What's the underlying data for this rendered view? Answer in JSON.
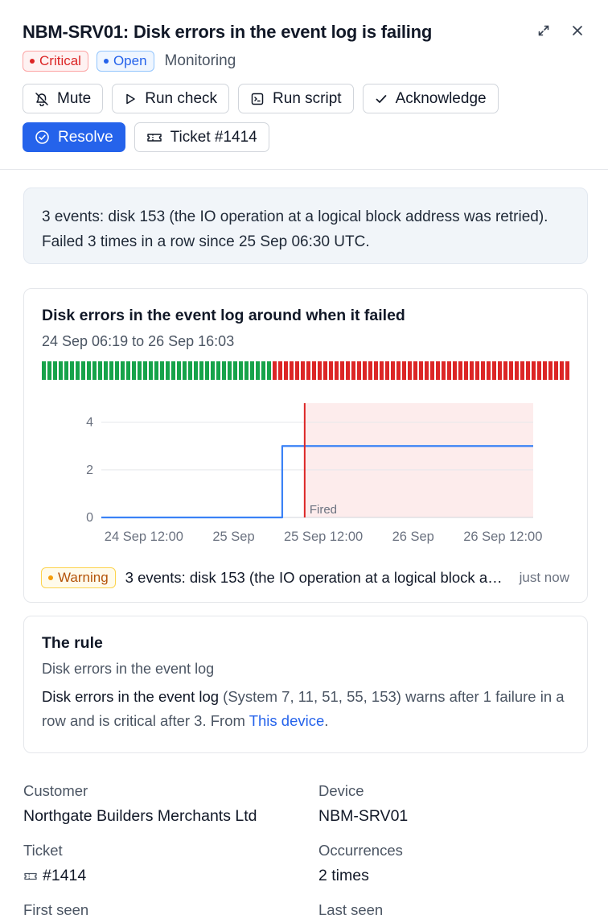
{
  "header": {
    "title": "NBM-SRV01: Disk errors in the event log is failing",
    "severity": "Critical",
    "status": "Open",
    "category": "Monitoring",
    "expand_icon": "expand-icon",
    "close_icon": "close-icon"
  },
  "actions": {
    "mute": "Mute",
    "run_check": "Run check",
    "run_script": "Run script",
    "acknowledge": "Acknowledge",
    "resolve": "Resolve",
    "ticket": "Ticket #1414"
  },
  "summary": "3 events: disk 153 (the IO operation at a logical block address was retried). Failed 3 times in a row since 25 Sep 06:30 UTC.",
  "chart_card": {
    "title": "Disk errors in the event log around when it failed",
    "range": "24 Sep 06:19 to 26 Sep 16:03",
    "strip": {
      "green_count": 41,
      "red_count": 53,
      "green": "#16a34a",
      "red": "#dc2626"
    },
    "latest_alert": {
      "level": "Warning",
      "text": "3 events: disk 153 (the IO operation at a logical block address was retried)",
      "time": "just now"
    }
  },
  "chart_data": {
    "type": "line",
    "x_ticks": [
      "24 Sep 12:00",
      "25 Sep",
      "25 Sep 12:00",
      "26 Sep",
      "26 Sep 12:00"
    ],
    "y_ticks": [
      0,
      2,
      4
    ],
    "ylim": [
      0,
      4.8
    ],
    "xlim": [
      "24 Sep 06:19",
      "26 Sep 16:03"
    ],
    "series": [
      {
        "x": [
          "24 Sep 06:19",
          "25 Sep 06:30",
          "25 Sep 06:30",
          "26 Sep 16:03"
        ],
        "values": [
          0,
          0,
          3,
          3
        ],
        "color": "#3b82f6"
      }
    ],
    "fired_at": "25 Sep 09:30",
    "fired_label": "Fired",
    "shaded_from": "25 Sep 09:30",
    "grid": true
  },
  "rule": {
    "heading": "The rule",
    "name": "Disk errors in the event log",
    "bold_name": "Disk errors in the event log",
    "description": " (System 7, 11, 51, 55, 153) warns after 1 failure in a row and is critical after 3. From ",
    "link": "This device",
    "tail": "."
  },
  "details": {
    "customer_label": "Customer",
    "customer": "Northgate Builders Merchants Ltd",
    "device_label": "Device",
    "device": "NBM-SRV01",
    "ticket_label": "Ticket",
    "ticket": "#1414",
    "occurrences_label": "Occurrences",
    "occurrences": "2 times",
    "first_seen_label": "First seen",
    "last_seen_label": "Last seen"
  }
}
